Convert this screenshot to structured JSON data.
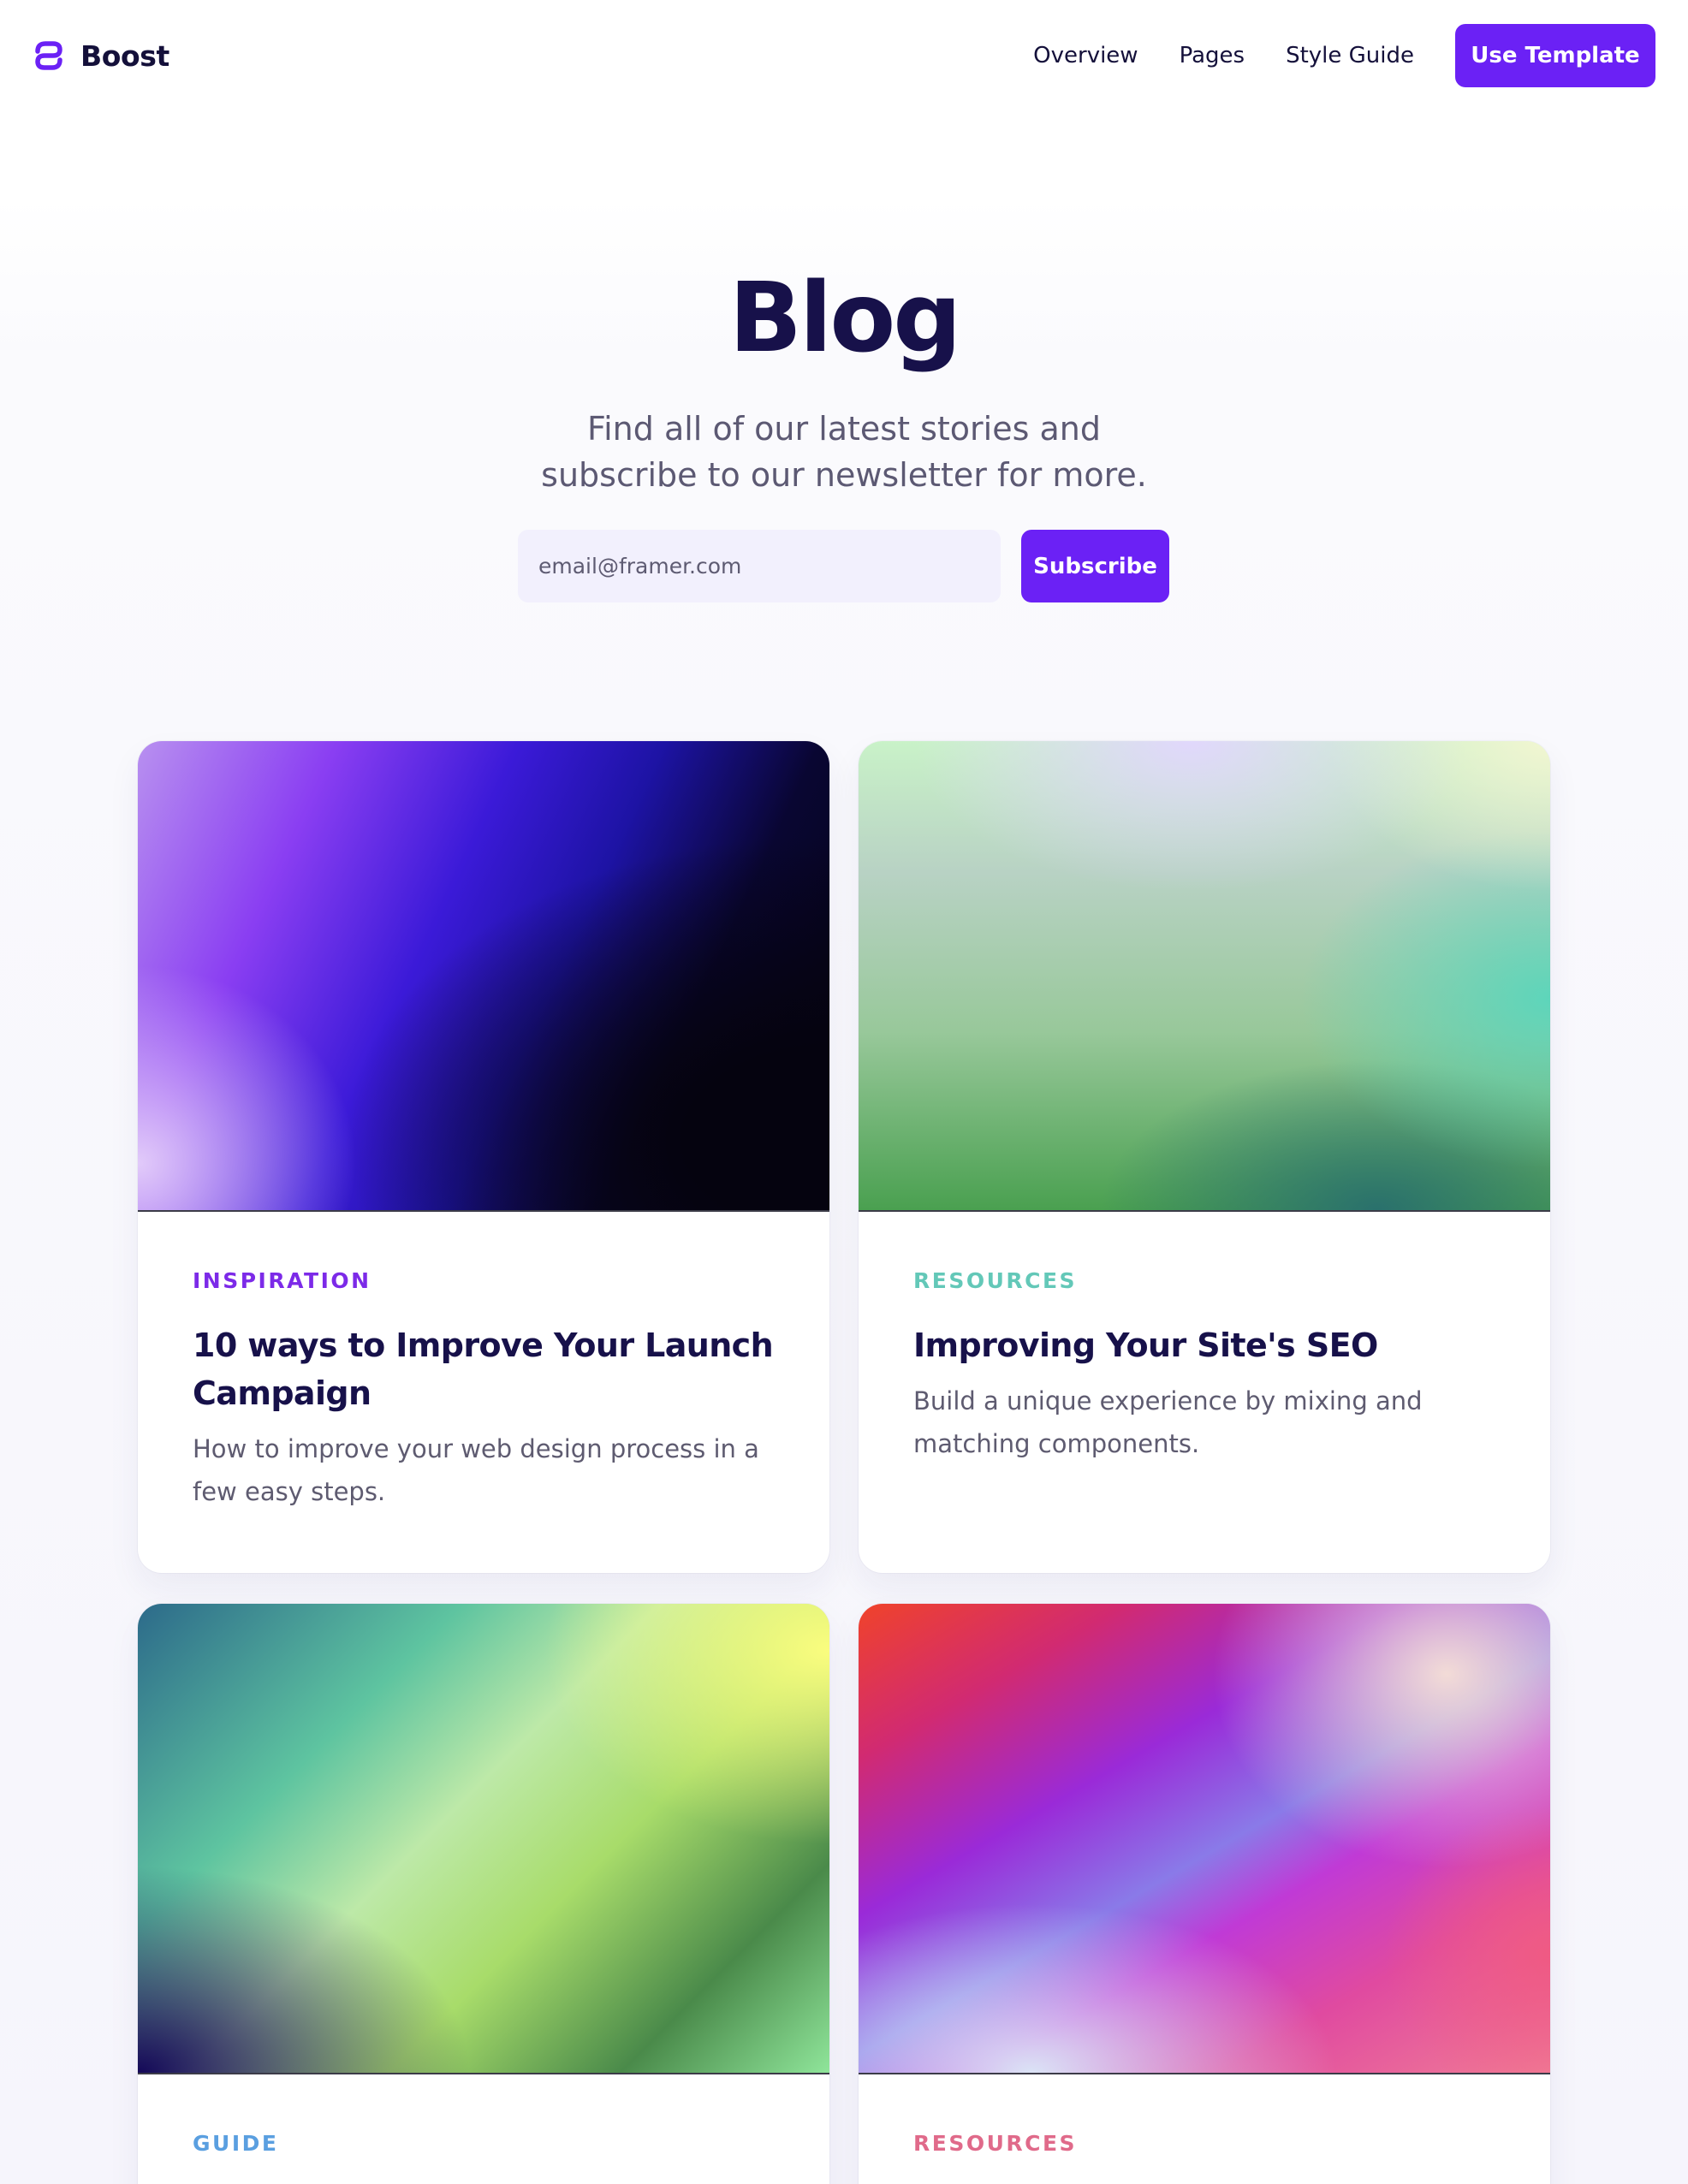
{
  "header": {
    "brand_name": "Boost",
    "brand_icon": "boost-logo-icon",
    "nav_links": [
      "Overview",
      "Pages",
      "Style Guide"
    ],
    "cta_label": "Use Template"
  },
  "hero": {
    "title": "Blog",
    "subtitle_lines": [
      "Find all of our latest stories and",
      "subscribe to our newsletter for more."
    ],
    "email_placeholder": "email@framer.com",
    "subscribe_label": "Subscribe"
  },
  "posts": [
    {
      "tag": "INSPIRATION",
      "tag_color": "#7c2ae8",
      "title": "10 ways to Improve Your Launch Campaign",
      "description": "How to improve your web design process in a few easy steps."
    },
    {
      "tag": "RESOURCES",
      "tag_color": "#63c8b8",
      "title": "Improving Your Site's SEO",
      "description": "Build a unique experience by mixing and matching components."
    },
    {
      "tag": "GUIDE",
      "tag_color": "#5a9fe0",
      "title": "",
      "description": ""
    },
    {
      "tag": "RESOURCES",
      "tag_color": "#e06a8a",
      "title": "",
      "description": ""
    }
  ],
  "colors": {
    "accent": "#6b21f5",
    "heading": "#17114a",
    "body_text": "#5e5b70"
  }
}
